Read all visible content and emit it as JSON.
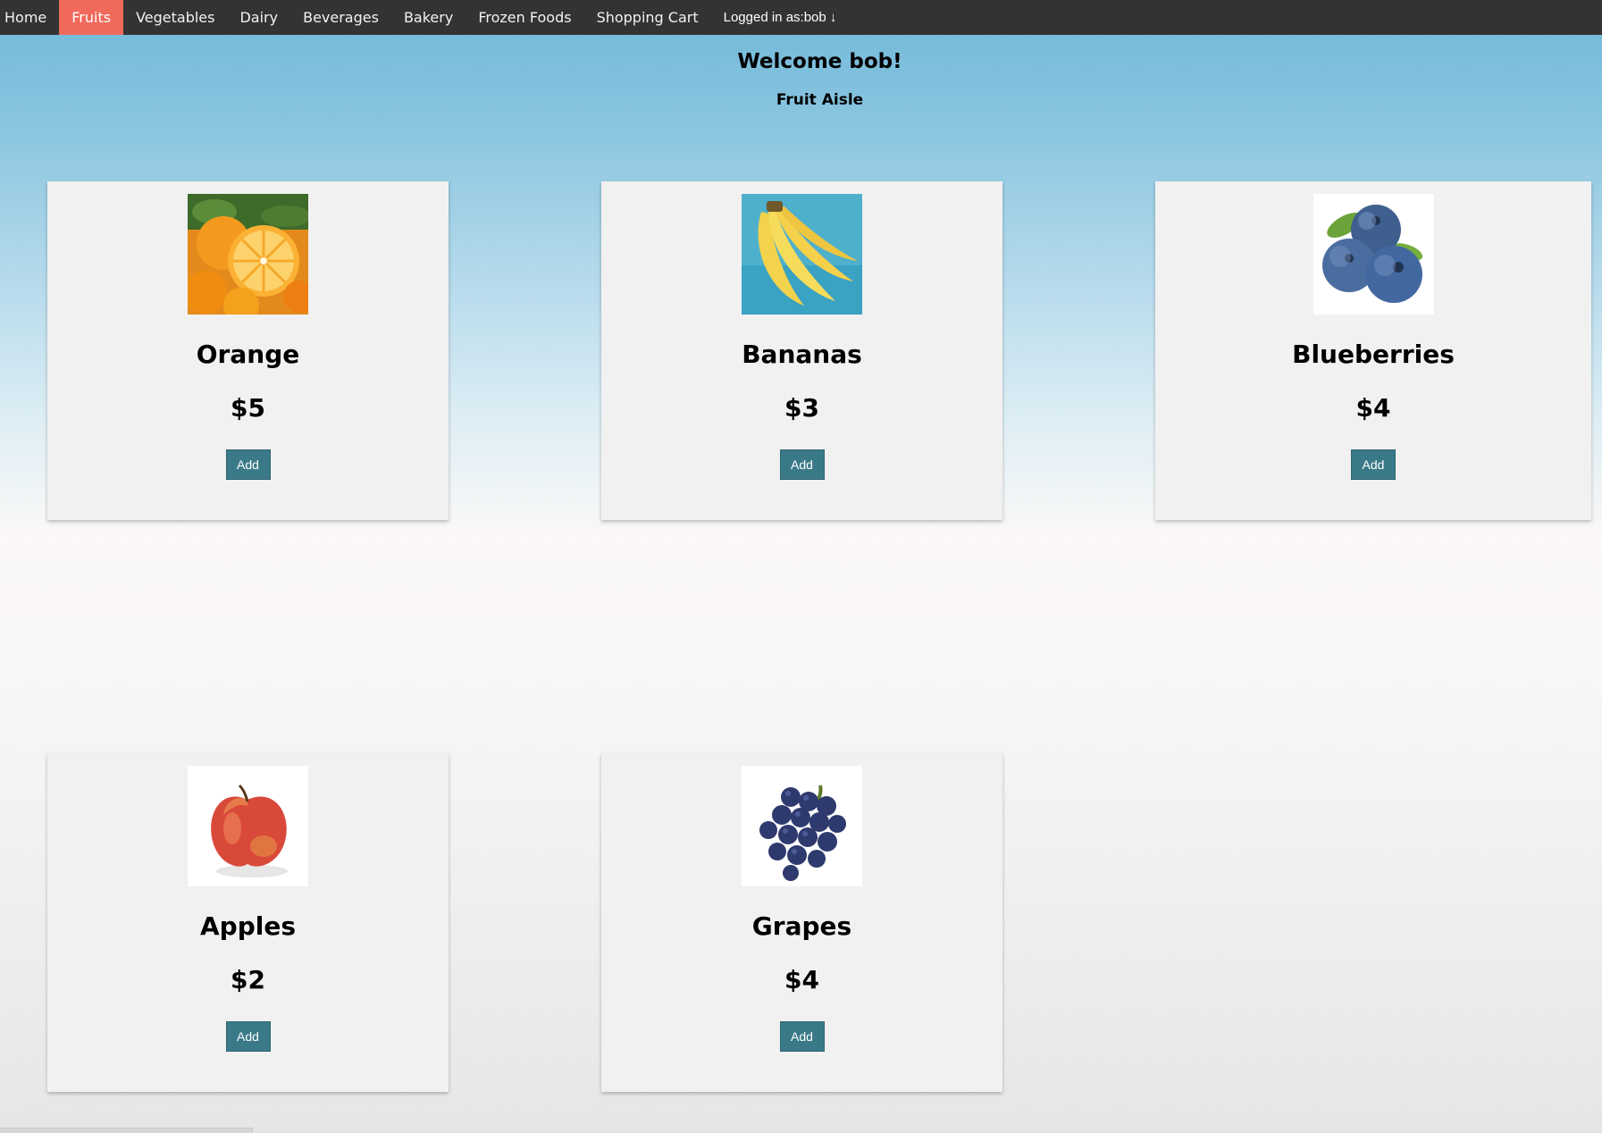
{
  "nav": {
    "items": [
      {
        "label": "Home"
      },
      {
        "label": "Fruits",
        "active": true
      },
      {
        "label": "Vegetables"
      },
      {
        "label": "Dairy"
      },
      {
        "label": "Beverages"
      },
      {
        "label": "Bakery"
      },
      {
        "label": "Frozen Foods"
      },
      {
        "label": "Shopping Cart"
      }
    ],
    "user_label": "Logged in as:bob ↓"
  },
  "welcome": "Welcome bob!",
  "aisle_title": "Fruit Aisle",
  "products": [
    {
      "name": "Orange",
      "price": "$5",
      "button": "Add",
      "icon": "orange-image"
    },
    {
      "name": "Bananas",
      "price": "$3",
      "button": "Add",
      "icon": "bananas-image"
    },
    {
      "name": "Blueberries",
      "price": "$4",
      "button": "Add",
      "icon": "blueberries-image"
    },
    {
      "name": "Apples",
      "price": "$2",
      "button": "Add",
      "icon": "apples-image"
    },
    {
      "name": "Grapes",
      "price": "$4",
      "button": "Add",
      "icon": "grapes-image"
    }
  ],
  "colors": {
    "navbar": "#333333",
    "active_tab": "#f0695b",
    "add_button": "#3a7a88",
    "card": "#f1f1f1"
  }
}
